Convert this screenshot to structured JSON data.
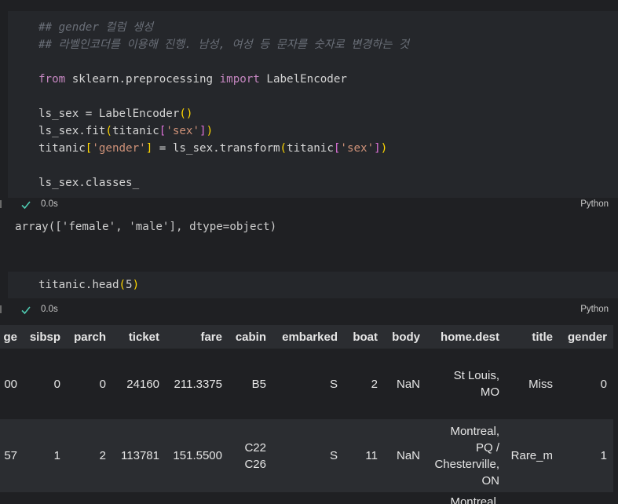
{
  "cell1": {
    "lines": [
      {
        "segments": [
          {
            "cls": "cmt",
            "text": "## gender 컬럼 생성"
          }
        ]
      },
      {
        "segments": [
          {
            "cls": "cmt",
            "text": "## 라벨인코더를 이용해 진행. 남성, 여성 등 문자를 숫자로 변경하는 것"
          }
        ]
      },
      {
        "segments": []
      },
      {
        "segments": [
          {
            "cls": "kw",
            "text": "from"
          },
          {
            "cls": "plain",
            "text": " sklearn.preprocessing "
          },
          {
            "cls": "kw",
            "text": "import"
          },
          {
            "cls": "plain",
            "text": " LabelEncoder"
          }
        ]
      },
      {
        "segments": []
      },
      {
        "segments": [
          {
            "cls": "plain",
            "text": "ls_sex = LabelEncoder"
          },
          {
            "cls": "br1",
            "text": "()"
          }
        ]
      },
      {
        "segments": [
          {
            "cls": "plain",
            "text": "ls_sex.fit"
          },
          {
            "cls": "br1",
            "text": "("
          },
          {
            "cls": "plain",
            "text": "titanic"
          },
          {
            "cls": "br2",
            "text": "["
          },
          {
            "cls": "str",
            "text": "'sex'"
          },
          {
            "cls": "br2",
            "text": "]"
          },
          {
            "cls": "br1",
            "text": ")"
          }
        ]
      },
      {
        "segments": [
          {
            "cls": "plain",
            "text": "titanic"
          },
          {
            "cls": "br1",
            "text": "["
          },
          {
            "cls": "str",
            "text": "'gender'"
          },
          {
            "cls": "br1",
            "text": "]"
          },
          {
            "cls": "plain",
            "text": " = ls_sex.transform"
          },
          {
            "cls": "br1",
            "text": "("
          },
          {
            "cls": "plain",
            "text": "titanic"
          },
          {
            "cls": "br2",
            "text": "["
          },
          {
            "cls": "str",
            "text": "'sex'"
          },
          {
            "cls": "br2",
            "text": "]"
          },
          {
            "cls": "br1",
            "text": ")"
          }
        ]
      },
      {
        "segments": []
      },
      {
        "segments": [
          {
            "cls": "plain",
            "text": "ls_sex.classes_"
          }
        ]
      }
    ],
    "status_time": "0.0s",
    "status_lang": "Python",
    "output": "array(['female', 'male'], dtype=object)"
  },
  "cell2": {
    "lines": [
      {
        "segments": [
          {
            "cls": "plain",
            "text": "titanic.head"
          },
          {
            "cls": "br1",
            "text": "("
          },
          {
            "cls": "plain",
            "text": "5"
          },
          {
            "cls": "br1",
            "text": ")"
          }
        ]
      }
    ],
    "status_time": "0.0s",
    "status_lang": "Python"
  },
  "dataframe": {
    "columns": [
      "ge",
      "sibsp",
      "parch",
      "ticket",
      "fare",
      "cabin",
      "embarked",
      "boat",
      "body",
      "home.dest",
      "title",
      "gender"
    ],
    "rows": [
      [
        "00",
        "0",
        "0",
        "24160",
        "211.3375",
        "B5",
        "S",
        "2",
        "NaN",
        "St Louis,\nMO",
        "Miss",
        "0"
      ],
      [
        "57",
        "1",
        "2",
        "113781",
        "151.5500",
        "C22\nC26",
        "S",
        "11",
        "NaN",
        "Montreal,\nPQ /\nChesterville,\nON",
        "Rare_m",
        "1"
      ],
      [
        "",
        "",
        "",
        "",
        "",
        "",
        "",
        "",
        "",
        "Montreal,",
        "",
        ""
      ]
    ]
  },
  "colors": {
    "background": "#1f2023",
    "cell_background": "#25272b",
    "header_background": "#2b2d31",
    "check_color": "#4ec9b0",
    "comment": "#6a6f78",
    "keyword": "#c586c0",
    "string": "#ce9178",
    "bracket_gold": "#ffd700",
    "bracket_pink": "#da70d6"
  },
  "icons": {
    "status_check": "check-icon"
  }
}
